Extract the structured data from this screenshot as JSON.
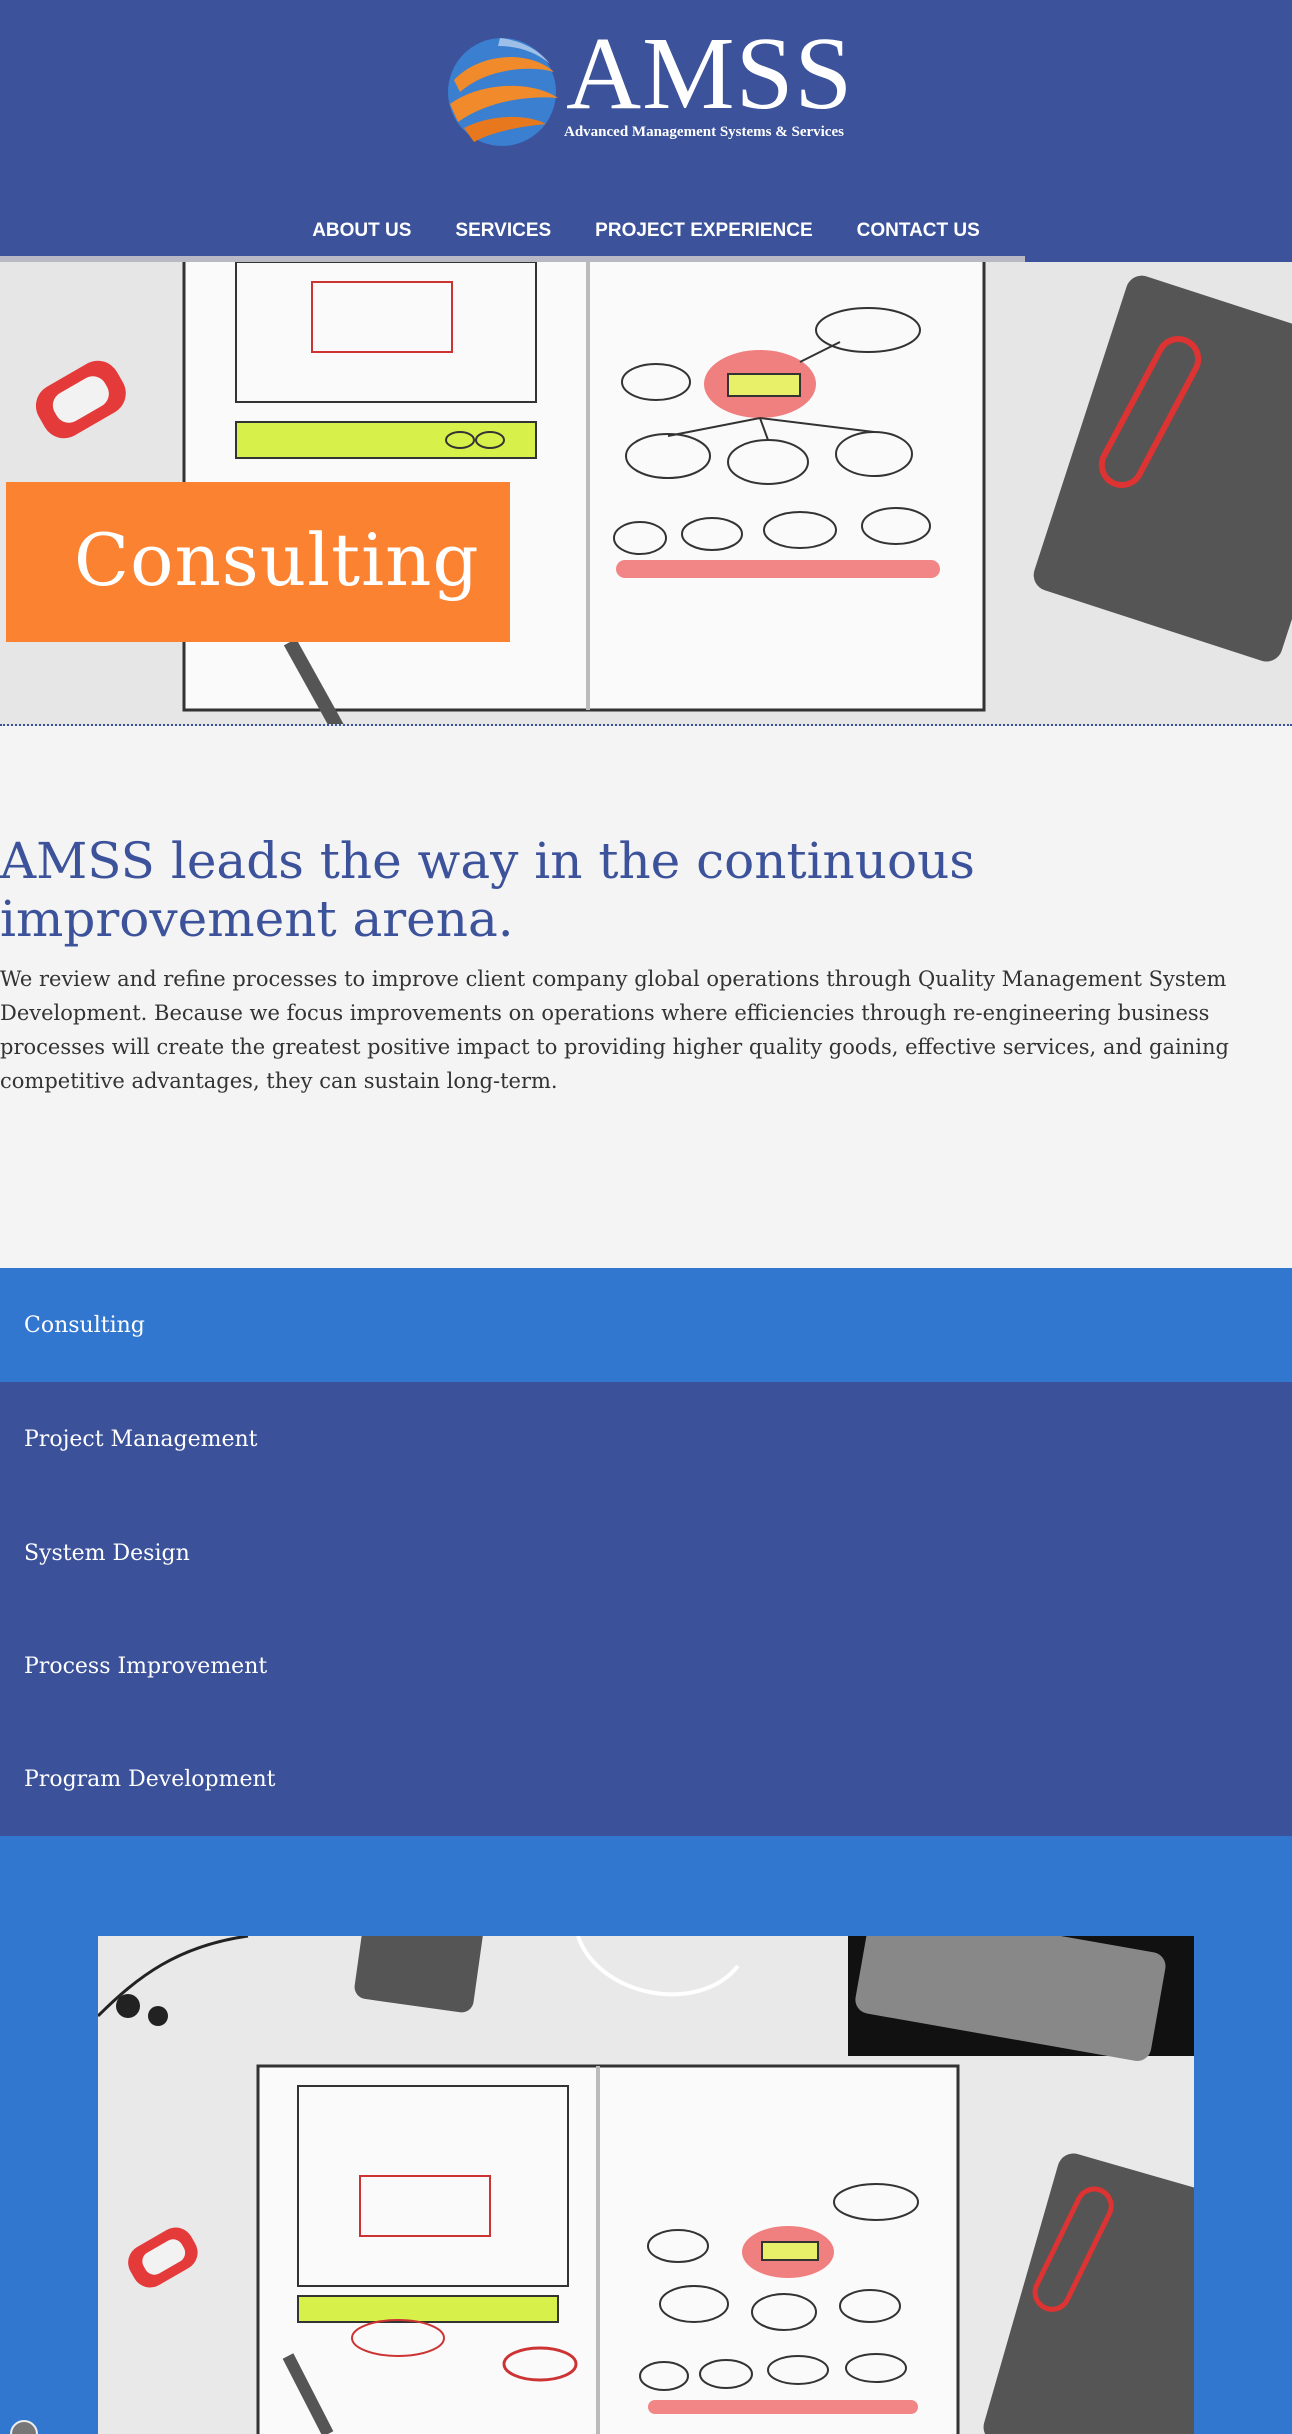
{
  "brand": {
    "name": "AMSS",
    "tagline": "Advanced Management Systems & Services"
  },
  "nav": {
    "items": [
      {
        "label": "ABOUT US"
      },
      {
        "label": "SERVICES"
      },
      {
        "label": "PROJECT EXPERIENCE"
      },
      {
        "label": "CONTACT US"
      }
    ]
  },
  "hero": {
    "title": "Consulting"
  },
  "intro": {
    "heading": "AMSS leads the way in the continuous improvement arena.",
    "body": "We review and refine processes to improve client company global operations through Quality Management System Development. Because we focus improvements on operations where efficiencies through re-engineering business processes will create the greatest positive impact to providing higher quality goods, effective services, and gaining competitive advantages, they can sustain long-term."
  },
  "services": {
    "items": [
      {
        "label": "Consulting",
        "active": true
      },
      {
        "label": "Project Management",
        "active": false
      },
      {
        "label": "System Design",
        "active": false
      },
      {
        "label": "Process Improvement",
        "active": false
      },
      {
        "label": "Program Development",
        "active": false
      }
    ]
  },
  "colors": {
    "header": "#3c529b",
    "accent_orange": "#fb8230",
    "active_blue": "#3277cf",
    "heading_blue": "#3c529b"
  }
}
